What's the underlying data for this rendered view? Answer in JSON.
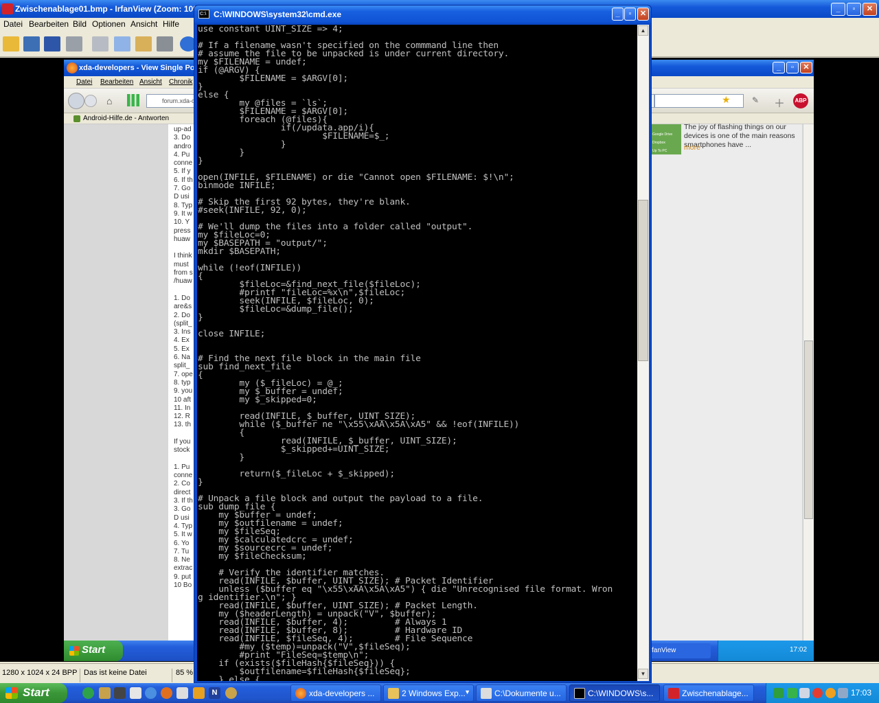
{
  "irfanview": {
    "title": "Zwischenablage01.bmp - IrfanView (Zoom: 1091",
    "menu": [
      "Datei",
      "Bearbeiten",
      "Bild",
      "Optionen",
      "Ansicht",
      "Hilfe"
    ],
    "status": {
      "dimensions": "1280 x 1024 x 24 BPP",
      "file": "Das ist keine Datei",
      "zoom": "85 %"
    }
  },
  "inner_screenshot": {
    "title": "xda-developers - View Single Post - F",
    "menu": [
      "Datei",
      "Bearbeiten",
      "Ansicht",
      "Chronik"
    ],
    "url_fragment": "forum.xda-d",
    "bookmark": "Android-Hilfe.de - Antworten",
    "left_snippets": [
      "up-ad",
      "3. Do",
      "andro",
      "4. Pu",
      "conne",
      "5. If y",
      "6. If th",
      "7. Go",
      "D usi",
      "8. Typ",
      "9. It w",
      "10. Y",
      "press",
      "huaw",
      "",
      "I think",
      "must",
      "from s",
      "/huaw",
      "",
      "1. Do",
      "are&s",
      "2. Do",
      "(split_",
      "3. Ins",
      "4. Ex",
      "5. Ex",
      "6. Na",
      "split_",
      "7. ope",
      "8. typ",
      "9. you",
      "10 aft",
      "11. In",
      "12. R",
      "13. th",
      "",
      "If you",
      "stock",
      "",
      "1. Pu",
      "conne",
      "2. Co",
      "direct",
      "3. If th",
      "3. Go",
      "D usi",
      "4. Typ",
      "5. It w",
      "6. Yo",
      "7. Tu",
      "8. Ne",
      "extrac",
      "9. put",
      "10 Bo"
    ],
    "right_panel_text": "The joy of flashing things on our devices is one of the main reasons smartphones have ...",
    "right_panel_more": "more",
    "sidebar_labels": [
      "Google Drive",
      "Dropbox",
      "Up To PC"
    ],
    "taskbar_start": "Start",
    "taskbar_item": "fanView",
    "clock": "17:02"
  },
  "cmd": {
    "title": "C:\\WINDOWS\\system32\\cmd.exe",
    "text": "use constant UINT_SIZE => 4;\n\n# If a filename wasn't specified on the commmand line then\n# assume the file to be unpacked is under current directory.\nmy $FILENAME = undef;\nif (@ARGV) {\n        $FILENAME = $ARGV[0];\n}\nelse {\n        my @files = `ls`;\n        $FILENAME = $ARGV[0];\n        foreach (@files){\n                if(/updata.app/i){\n                        $FILENAME=$_;\n                }\n        }\n}\n\nopen(INFILE, $FILENAME) or die \"Cannot open $FILENAME: $!\\n\";\nbinmode INFILE;\n\n# Skip the first 92 bytes, they're blank.\n#seek(INFILE, 92, 0);\n\n# We'll dump the files into a folder called \"output\".\nmy $fileLoc=0;\nmy $BASEPATH = \"output/\";\nmkdir $BASEPATH;\n\nwhile (!eof(INFILE))\n{\n        $fileLoc=&find_next_file($fileLoc);\n        #printf \"fileLoc=%x\\n\",$fileLoc;\n        seek(INFILE, $fileLoc, 0);\n        $fileLoc=&dump_file();\n}\n\nclose INFILE;\n\n\n# Find the next file block in the main file\nsub find_next_file\n{\n        my ($_fileLoc) = @_;\n        my $_buffer = undef;\n        my $_skipped=0;\n\n        read(INFILE, $_buffer, UINT_SIZE);\n        while ($_buffer ne \"\\x55\\xAA\\x5A\\xA5\" && !eof(INFILE))\n        {\n                read(INFILE, $_buffer, UINT_SIZE);\n                $_skipped+=UINT_SIZE;\n        }\n\n        return($_fileLoc + $_skipped);\n}\n\n# Unpack a file block and output the payload to a file.\nsub dump_file {\n    my $buffer = undef;\n    my $outfilename = undef;\n    my $fileSeq;\n    my $calculatedcrc = undef;\n    my $sourcecrc = undef;\n    my $fileChecksum;\n\n    # Verify the identifier matches.\n    read(INFILE, $buffer, UINT_SIZE); # Packet Identifier\n    unless ($buffer eq \"\\x55\\xAA\\x5A\\xA5\") { die \"Unrecognised file format. Wron\ng identifier.\\n\"; }\n    read(INFILE, $buffer, UINT_SIZE); # Packet Length.\n    my ($headerLength) = unpack(\"V\", $buffer);\n    read(INFILE, $buffer, 4);         # Always 1\n    read(INFILE, $buffer, 8);         # Hardware ID\n    read(INFILE, $fileSeq, 4);        # File Sequence\n        #my ($temp)=unpack(\"V\",$fileSeq);\n        #print \"FileSeq=$temp\\n\";\n    if (exists($fileHash{$fileSeq})) {\n        $outfilename=$fileHash{$fileSeq};\n    } else {"
  },
  "taskbar": {
    "start_label": "Start",
    "tasks": [
      {
        "label": "xda-developers ...",
        "active": false
      },
      {
        "label": "2 Windows Exp...",
        "active": false
      },
      {
        "label": "C:\\Dokumente u...",
        "active": false
      },
      {
        "label": "C:\\WINDOWS\\s...",
        "active": true
      },
      {
        "label": "Zwischenablage...",
        "active": false
      }
    ],
    "clock": "17:03"
  },
  "colors": {
    "xp_blue": "#245edb",
    "start_green": "#3a9638",
    "console_text": "#c0c0c0",
    "console_bg": "#000000"
  }
}
